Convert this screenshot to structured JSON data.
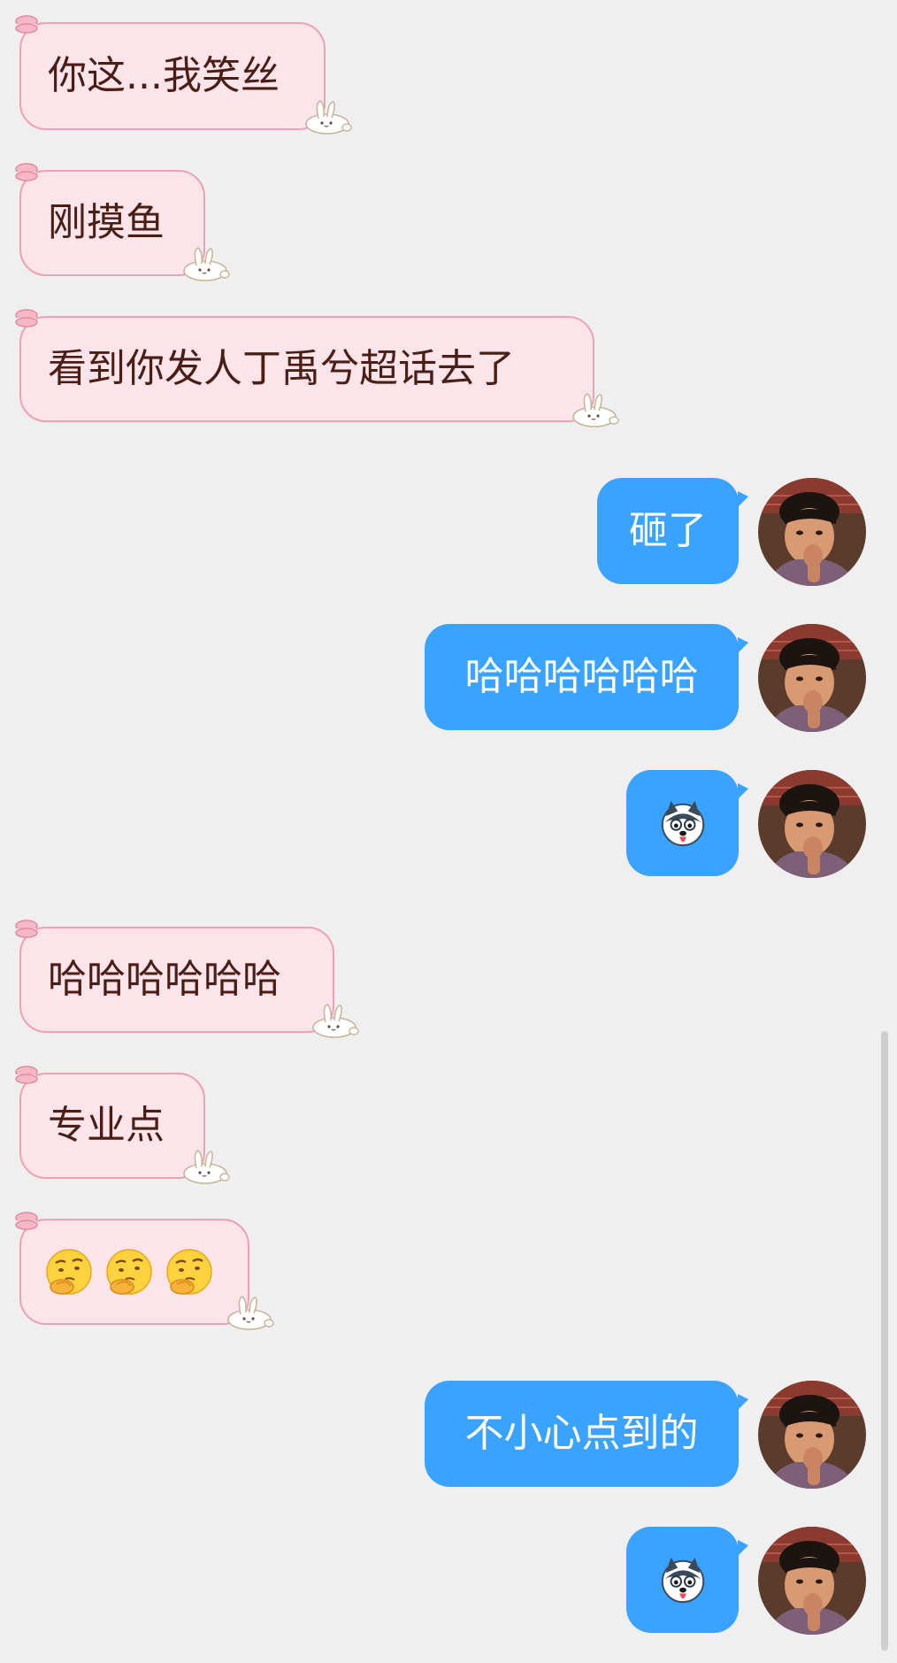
{
  "messages": [
    {
      "side": "in",
      "type": "text",
      "text": "你这...我笑丝"
    },
    {
      "side": "in",
      "type": "text",
      "text": "刚摸鱼"
    },
    {
      "side": "in",
      "type": "text",
      "text": "看到你发人丁禹兮超话去了"
    },
    {
      "side": "out",
      "type": "text",
      "text": "砸了"
    },
    {
      "side": "out",
      "type": "text",
      "text": "哈哈哈哈哈哈"
    },
    {
      "side": "out",
      "type": "sticker",
      "sticker": "husky-tongue-emoji"
    },
    {
      "side": "in",
      "type": "text",
      "text": "哈哈哈哈哈哈"
    },
    {
      "side": "in",
      "type": "text",
      "text": "专业点"
    },
    {
      "side": "in",
      "type": "emoji",
      "emoji": "thinking-face-emoji",
      "count": 3
    },
    {
      "side": "out",
      "type": "text",
      "text": "不小心点到的"
    },
    {
      "side": "out",
      "type": "sticker",
      "sticker": "husky-tongue-emoji"
    }
  ],
  "colors": {
    "background": "#efeff0",
    "incoming_bubble": "#fbe4ea",
    "incoming_border": "#f0a0b4",
    "incoming_text": "#4a1e14",
    "outgoing_bubble": "#3aa2ff",
    "outgoing_text": "#ffffff"
  },
  "icons": {
    "incoming_top_decoration": "macaron-icon",
    "incoming_corner_decoration": "bunny-icon",
    "avatar": "user-avatar"
  }
}
